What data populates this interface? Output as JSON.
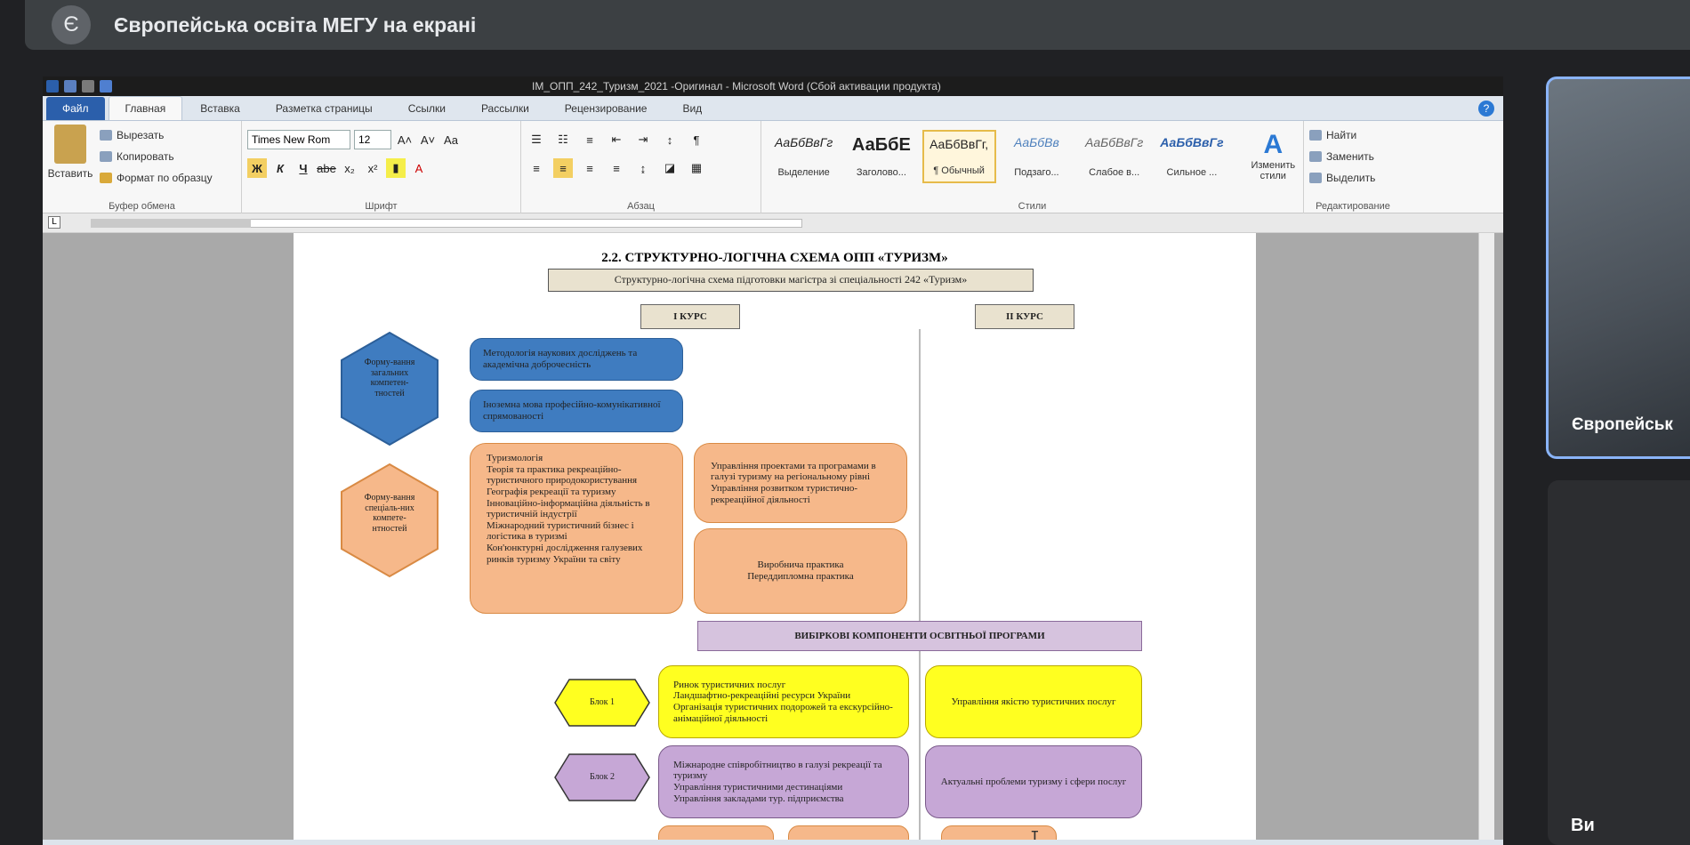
{
  "meeting": {
    "badge": "Є",
    "title": "Європейська освіта МЕГУ на екрані"
  },
  "word": {
    "title": "IM_ОПП_242_Туризм_2021 -Оригинал - Microsoft Word (Сбой активации продукта)",
    "tabs": [
      "Файл",
      "Главная",
      "Вставка",
      "Разметка страницы",
      "Ссылки",
      "Рассылки",
      "Рецензирование",
      "Вид"
    ],
    "help": "?",
    "clipboard": {
      "paste": "Вставить",
      "cut": "Вырезать",
      "copy": "Копировать",
      "format": "Формат по образцу",
      "label": "Буфер обмена"
    },
    "font": {
      "name": "Times New Rom",
      "size": "12",
      "label": "Шрифт",
      "bold": "Ж",
      "italic": "К",
      "underline": "Ч",
      "strike": "abe",
      "sub": "x₂",
      "sup": "x²",
      "grow": "A˄",
      "shrink": "A˅",
      "case": "Aa"
    },
    "paragraph": {
      "label": "Абзац",
      "pilcrow": "¶"
    },
    "styles": {
      "label": "Стили",
      "items": [
        {
          "preview": "АаБбВвГг",
          "name": "Выделение"
        },
        {
          "preview": "АаБбE",
          "name": "Заголово..."
        },
        {
          "preview": "АаБбВвГг,",
          "name": "¶ Обычный"
        },
        {
          "preview": "АаБбВв",
          "name": "Подзаго..."
        },
        {
          "preview": "АаБбВвГг",
          "name": "Слабое в..."
        },
        {
          "preview": "АаБбВвГг",
          "name": "Сильное ..."
        }
      ],
      "change": "Изменить стили"
    },
    "editing": {
      "label": "Редактирование",
      "find": "Найти",
      "replace": "Заменить",
      "select": "Выделить"
    },
    "ruler": "L"
  },
  "doc": {
    "heading": "2.2. СТРУКТУРНО-ЛОГІЧНА СХЕМА ОПП «ТУРИЗМ»",
    "subtitle": "Структурно-логічна схема підготовки магістра зі спеціальності 242 «Туризм»",
    "course1": "І КУРС",
    "course2": "ІІ КУРС",
    "hex1": "Форму-вання загальних компетен-тностей",
    "hex2": "Форму-вання спеціаль-них компете-нтностей",
    "blue1": "Методологія наукових досліджень та академічна доброчесність",
    "blue2": "Іноземна мова професійно-комунікативної спрямованості",
    "orange_list": "Туризмологія\nТеорія та практика рекреаційно-туристичного природокористування\nГеографія рекреації та туризму\nІнноваційно-інформаційна діяльність в туристичній індустрії\nМіжнародний туристичний бізнес і логістика в туризмі\nКон'юнктурні дослідження галузевих ринків туризму України та світу",
    "orange2": "Управління проектами та програмами в галузі туризму на регіональному рівні\nУправління розвитком туристично-рекреаційної діяльності",
    "orange3": "Виробнича практика\nПереддипломна практика",
    "elective": "ВИБІРКОВІ КОМПОНЕНТИ ОСВІТНЬОЇ ПРОГРАМИ",
    "block1": "Блок 1",
    "block2": "Блок 2",
    "yellow1": "Ринок туристичних послуг\nЛандшафтно-рекреаційні ресурси України\nОрганізація туристичних подорожей та екскурсійно-анімаційної діяльності",
    "yellow2": "Управління якістю туристичних послуг",
    "purple1": "Міжнародне співробітництво в галузі рекреації та туризму\nУправління туристичними дестинаціями\nУправління закладами тур. підприємства",
    "purple2": "Актуальні проблеми туризму і сфери послуг"
  },
  "participants": {
    "main": "Європейськ",
    "you": "Ви"
  }
}
